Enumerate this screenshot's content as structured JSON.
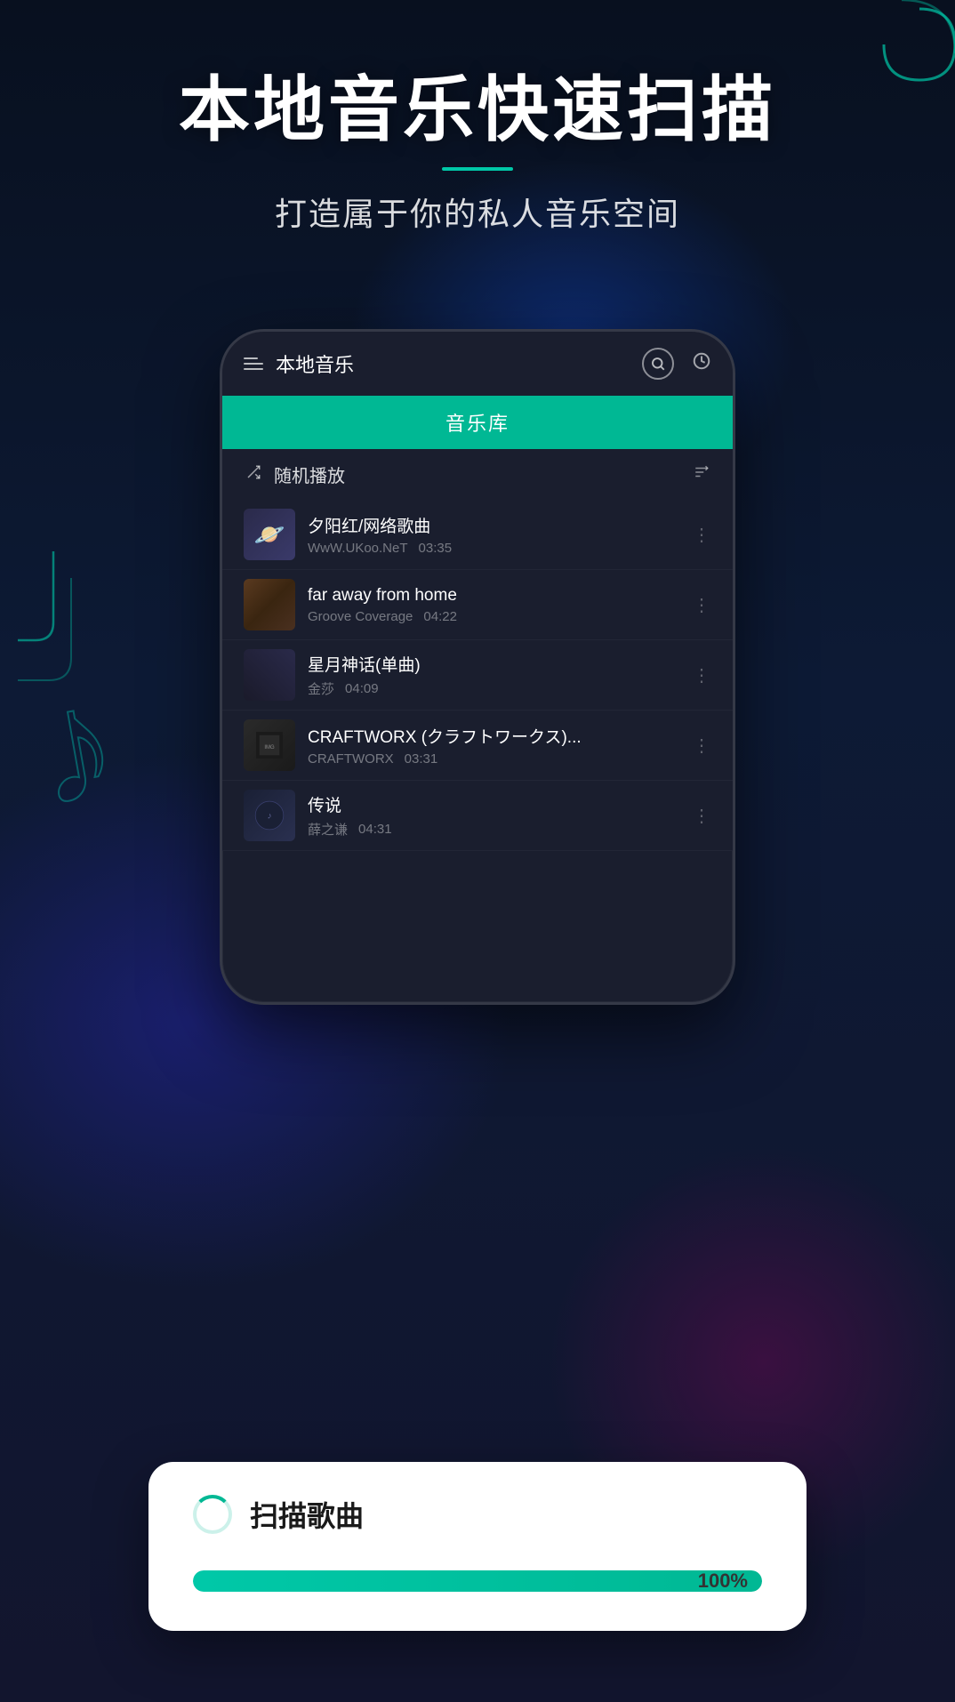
{
  "hero": {
    "title": "本地音乐快速扫描",
    "divider": true,
    "subtitle": "打造属于你的私人音乐空间"
  },
  "phone": {
    "header": {
      "title": "本地音乐",
      "search_icon": "search-icon",
      "clock_icon": "clock-icon"
    },
    "library_tab": "音乐库",
    "shuffle": {
      "label": "随机播放"
    },
    "songs": [
      {
        "title": "夕阳红/网络歌曲",
        "artist": "WwW.UKoo.NeT",
        "duration": "03:35",
        "thumb_type": "1"
      },
      {
        "title": "far away from home",
        "artist": "Groove Coverage",
        "duration": "04:22",
        "thumb_type": "2"
      },
      {
        "title": "星月神话(单曲)",
        "artist": "金莎",
        "duration": "04:09",
        "thumb_type": "3"
      },
      {
        "title": "CRAFTWORX (クラフトワークス)...",
        "artist": "CRAFTWORX",
        "duration": "03:31",
        "thumb_type": "4"
      },
      {
        "title": "传说",
        "artist": "薛之谦",
        "duration": "04:31",
        "thumb_type": "5"
      }
    ]
  },
  "scan_dialog": {
    "spinner_visible": true,
    "title": "扫描歌曲",
    "progress_percent": 100,
    "progress_label": "100%"
  },
  "colors": {
    "accent": "#00b894",
    "background": "#0a1628",
    "phone_bg": "#1a1e2e"
  }
}
